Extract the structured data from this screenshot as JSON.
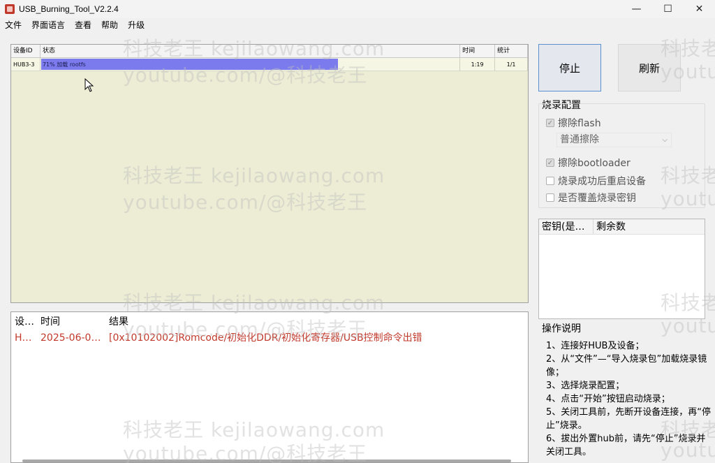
{
  "window": {
    "title": "USB_Burning_Tool_V2.2.4",
    "minimize": "—",
    "maximize": "☐",
    "close": "✕"
  },
  "menu": {
    "items": [
      "文件",
      "界面语言",
      "查看",
      "帮助",
      "升级"
    ]
  },
  "device_table": {
    "headers": {
      "id": "设备ID",
      "state": "状态",
      "time": "时间",
      "count": "统计"
    },
    "rows": [
      {
        "id": "HUB3-3",
        "state": "71% 加载 rootfs",
        "progress": 0.71,
        "time": "1:19",
        "count": "1/1"
      }
    ]
  },
  "log": {
    "headers": {
      "device": "设…",
      "time": "时间",
      "result": "结果"
    },
    "rows": [
      {
        "device": "H…",
        "time": "2025-06-0…",
        "result": "[0x10102002]Romcode/初始化DDR/初始化寄存器/USB控制命令出错"
      }
    ]
  },
  "buttons": {
    "stop": "停止",
    "refresh": "刷新"
  },
  "config": {
    "title": "烧录配置",
    "erase_flash": "擦除flash",
    "erase_mode": "普通擦除",
    "erase_bootloader": "擦除bootloader",
    "reboot_after": "烧录成功后重启设备",
    "overwrite_key": "是否覆盖烧录密钥"
  },
  "key_table": {
    "col1": "密钥(是…",
    "col2": "剩余数"
  },
  "instructions": {
    "title": "操作说明",
    "items": [
      "1、连接好HUB及设备；",
      "2、从“文件”—“导入烧录包”加载烧录镜像；",
      "3、选择烧录配置；",
      "4、点击“开始”按钮启动烧录；",
      "5、关闭工具前，先断开设备连接，再“停止”烧录。",
      "6、拔出外置hub前，请先“停止”烧录并关闭工具。"
    ]
  },
  "watermark": {
    "line1": "科技老王 kejilaowang.com",
    "line2": "youtube.com/@科技老王",
    "short1": "科技老",
    "short2": "youtu"
  }
}
